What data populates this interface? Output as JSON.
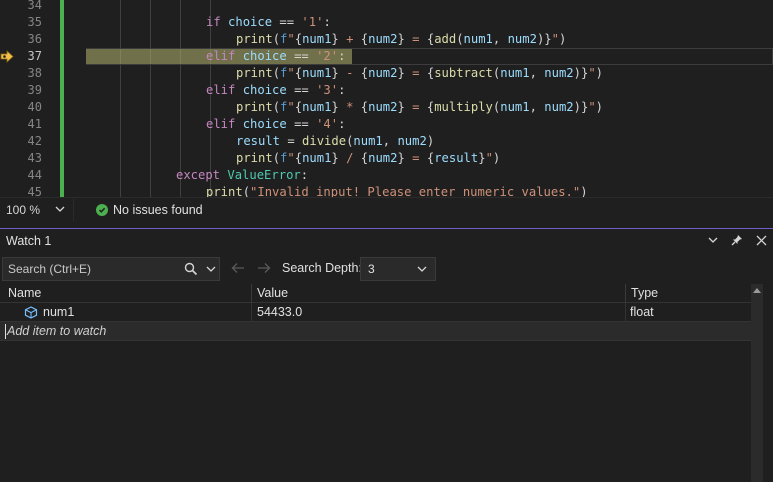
{
  "editor": {
    "lines": [
      {
        "num": "34",
        "indent": 0,
        "tokens": []
      },
      {
        "num": "35",
        "indent": 4,
        "tokens": [
          [
            "kw2",
            "if"
          ],
          [
            "plain",
            " "
          ],
          [
            "var",
            "choice"
          ],
          [
            "plain",
            " == "
          ],
          [
            "str",
            "'1'"
          ],
          [
            "plain",
            ":"
          ]
        ]
      },
      {
        "num": "36",
        "indent": 5,
        "tokens": [
          [
            "fn",
            "print"
          ],
          [
            "plain",
            "("
          ],
          [
            "kw",
            "f"
          ],
          [
            "str",
            "\""
          ],
          [
            "plain",
            "{"
          ],
          [
            "var",
            "num1"
          ],
          [
            "plain",
            "}"
          ],
          [
            "str",
            " + "
          ],
          [
            "plain",
            "{"
          ],
          [
            "var",
            "num2"
          ],
          [
            "plain",
            "}"
          ],
          [
            "str",
            " = "
          ],
          [
            "plain",
            "{"
          ],
          [
            "fn",
            "add"
          ],
          [
            "plain",
            "("
          ],
          [
            "var",
            "num1"
          ],
          [
            "plain",
            ", "
          ],
          [
            "var",
            "num2"
          ],
          [
            "plain",
            ")}"
          ],
          [
            "str",
            "\""
          ],
          [
            "plain",
            ")"
          ]
        ]
      },
      {
        "num": "37",
        "indent": 4,
        "current": true,
        "tokens": [
          [
            "kw2",
            "elif"
          ],
          [
            "plain",
            " "
          ],
          [
            "var",
            "choice"
          ],
          [
            "plain",
            " == "
          ],
          [
            "str",
            "'2'"
          ],
          [
            "plain",
            ":"
          ]
        ]
      },
      {
        "num": "38",
        "indent": 5,
        "tokens": [
          [
            "fn",
            "print"
          ],
          [
            "plain",
            "("
          ],
          [
            "kw",
            "f"
          ],
          [
            "str",
            "\""
          ],
          [
            "plain",
            "{"
          ],
          [
            "var",
            "num1"
          ],
          [
            "plain",
            "}"
          ],
          [
            "str",
            " - "
          ],
          [
            "plain",
            "{"
          ],
          [
            "var",
            "num2"
          ],
          [
            "plain",
            "}"
          ],
          [
            "str",
            " = "
          ],
          [
            "plain",
            "{"
          ],
          [
            "fn",
            "subtract"
          ],
          [
            "plain",
            "("
          ],
          [
            "var",
            "num1"
          ],
          [
            "plain",
            ", "
          ],
          [
            "var",
            "num2"
          ],
          [
            "plain",
            ")}"
          ],
          [
            "str",
            "\""
          ],
          [
            "plain",
            ")"
          ]
        ]
      },
      {
        "num": "39",
        "indent": 4,
        "tokens": [
          [
            "kw2",
            "elif"
          ],
          [
            "plain",
            " "
          ],
          [
            "var",
            "choice"
          ],
          [
            "plain",
            " == "
          ],
          [
            "str",
            "'3'"
          ],
          [
            "plain",
            ":"
          ]
        ]
      },
      {
        "num": "40",
        "indent": 5,
        "tokens": [
          [
            "fn",
            "print"
          ],
          [
            "plain",
            "("
          ],
          [
            "kw",
            "f"
          ],
          [
            "str",
            "\""
          ],
          [
            "plain",
            "{"
          ],
          [
            "var",
            "num1"
          ],
          [
            "plain",
            "}"
          ],
          [
            "str",
            " * "
          ],
          [
            "plain",
            "{"
          ],
          [
            "var",
            "num2"
          ],
          [
            "plain",
            "}"
          ],
          [
            "str",
            " = "
          ],
          [
            "plain",
            "{"
          ],
          [
            "fn",
            "multiply"
          ],
          [
            "plain",
            "("
          ],
          [
            "var",
            "num1"
          ],
          [
            "plain",
            ", "
          ],
          [
            "var",
            "num2"
          ],
          [
            "plain",
            ")}"
          ],
          [
            "str",
            "\""
          ],
          [
            "plain",
            ")"
          ]
        ]
      },
      {
        "num": "41",
        "indent": 4,
        "tokens": [
          [
            "kw2",
            "elif"
          ],
          [
            "plain",
            " "
          ],
          [
            "var",
            "choice"
          ],
          [
            "plain",
            " == "
          ],
          [
            "str",
            "'4'"
          ],
          [
            "plain",
            ":"
          ]
        ]
      },
      {
        "num": "42",
        "indent": 5,
        "tokens": [
          [
            "var",
            "result"
          ],
          [
            "plain",
            " = "
          ],
          [
            "fn",
            "divide"
          ],
          [
            "plain",
            "("
          ],
          [
            "var",
            "num1"
          ],
          [
            "plain",
            ", "
          ],
          [
            "var",
            "num2"
          ],
          [
            "plain",
            ")"
          ]
        ]
      },
      {
        "num": "43",
        "indent": 5,
        "tokens": [
          [
            "fn",
            "print"
          ],
          [
            "plain",
            "("
          ],
          [
            "kw",
            "f"
          ],
          [
            "str",
            "\""
          ],
          [
            "plain",
            "{"
          ],
          [
            "var",
            "num1"
          ],
          [
            "plain",
            "}"
          ],
          [
            "str",
            " / "
          ],
          [
            "plain",
            "{"
          ],
          [
            "var",
            "num2"
          ],
          [
            "plain",
            "}"
          ],
          [
            "str",
            " = "
          ],
          [
            "plain",
            "{"
          ],
          [
            "var",
            "result"
          ],
          [
            "plain",
            "}"
          ],
          [
            "str",
            "\""
          ],
          [
            "plain",
            ")"
          ]
        ]
      },
      {
        "num": "44",
        "indent": 3,
        "tokens": [
          [
            "kw2",
            "except"
          ],
          [
            "plain",
            " "
          ],
          [
            "cls",
            "ValueError"
          ],
          [
            "plain",
            ":"
          ]
        ]
      },
      {
        "num": "45",
        "indent": 4,
        "tokens": [
          [
            "fn",
            "print"
          ],
          [
            "plain",
            "("
          ],
          [
            "str",
            "\"Invalid input! Please enter numeric values.\""
          ],
          [
            "plain",
            ")"
          ]
        ]
      }
    ]
  },
  "status": {
    "zoom": "100 %",
    "issues": "No issues found"
  },
  "watch": {
    "title": "Watch 1",
    "search_placeholder": "Search (Ctrl+E)",
    "depth_label": "Search Depth:",
    "depth_value": "3",
    "columns": {
      "name": "Name",
      "value": "Value",
      "type": "Type"
    },
    "rows": [
      {
        "name": "num1",
        "value": "54433.0",
        "type": "float"
      }
    ],
    "add_item": "Add item to watch"
  },
  "colors": {
    "keyword": "#569cd6",
    "control": "#c586c0",
    "string": "#ce9178",
    "function": "#dcdcaa",
    "class": "#4ec9b0",
    "variable": "#9cdcfe",
    "change_bar": "#4caf50",
    "exec_highlight": "#b2b46e",
    "panel_accent": "#6c5fc7"
  },
  "icons": [
    "execution-pointer-icon",
    "chevron-down-icon",
    "check-circle-icon",
    "search-icon",
    "back-arrow-icon",
    "forward-arrow-icon",
    "pin-icon",
    "close-icon",
    "variable-icon"
  ]
}
